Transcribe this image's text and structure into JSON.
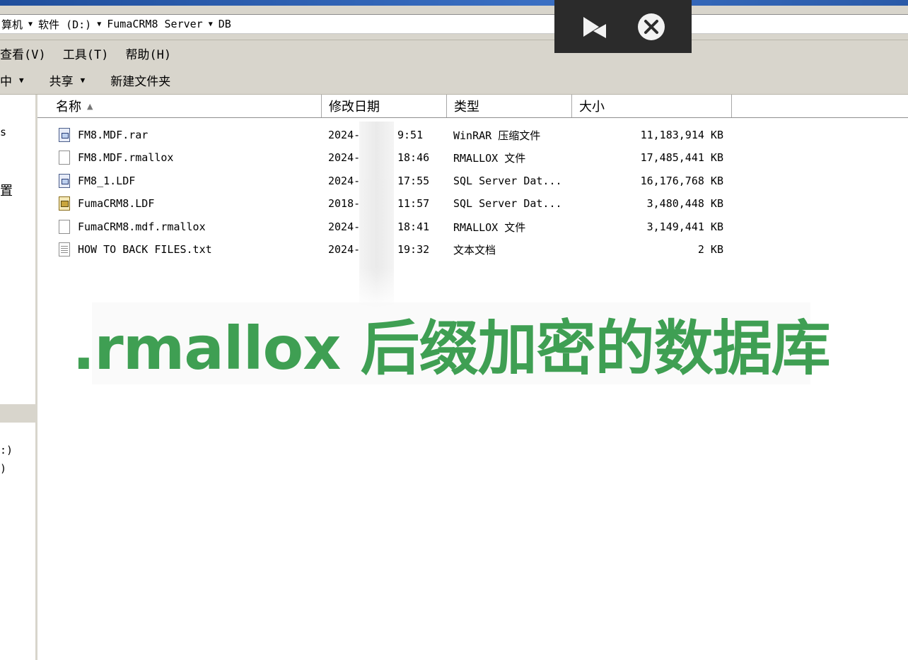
{
  "address_bar": {
    "crumbs": [
      "算机",
      "软件 (D:)",
      "FumaCRM8 Server",
      "DB"
    ]
  },
  "menubar": {
    "items": [
      "查看(V)",
      "工具(T)",
      "帮助(H)"
    ]
  },
  "toolbar": {
    "items": [
      "中",
      "共享",
      "新建文件夹"
    ]
  },
  "nav_pane": {
    "fragments": [
      "s",
      "置",
      ":)",
      ")"
    ]
  },
  "columns": {
    "name": "名称",
    "date": "修改日期",
    "type": "类型",
    "size": "大小"
  },
  "files": [
    {
      "name": "FM8.MDF.rar",
      "date": "2024-",
      "time": "9:51",
      "type": "WinRAR 压缩文件",
      "size": "11,183,914 KB",
      "icon": "rar-archive-icon"
    },
    {
      "name": "FM8.MDF.rmallox",
      "date": "2024-",
      "time": "18:46",
      "type": "RMALLOX 文件",
      "size": "17,485,441 KB",
      "icon": "blank-file-icon"
    },
    {
      "name": "FM8_1.LDF",
      "date": "2024-",
      "time": "17:55",
      "type": "SQL Server Dat...",
      "size": "16,176,768 KB",
      "icon": "rar-archive-icon"
    },
    {
      "name": "FumaCRM8.LDF",
      "date": "2018-",
      "time": "11:57",
      "type": "SQL Server Dat...",
      "size": "3,480,448 KB",
      "icon": "sql-log-file-icon"
    },
    {
      "name": "FumaCRM8.mdf.rmallox",
      "date": "2024-",
      "time": "18:41",
      "type": "RMALLOX 文件",
      "size": "3,149,441 KB",
      "icon": "blank-file-icon"
    },
    {
      "name": "HOW TO BACK FILES.txt",
      "date": "2024-",
      "time": "19:32",
      "type": "文本文档",
      "size": "2 KB",
      "icon": "text-file-icon"
    }
  ],
  "caption": ".rmallox 后缀加密的数据库",
  "colors": {
    "caption": "#3f9f53",
    "chrome": "#d8d5cc",
    "overlay": "#2b2b2b"
  }
}
